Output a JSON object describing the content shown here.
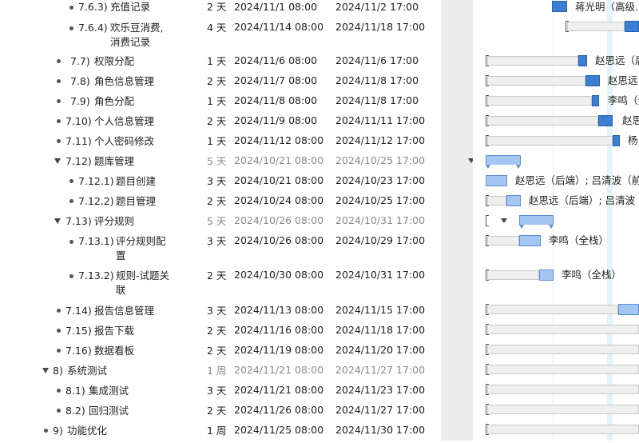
{
  "tasks": [
    {
      "num": "7.6.3)",
      "name": "充值记录",
      "duration": "2 天",
      "start": "2024/11/1 08:00",
      "end": "2024/11/2 17:00"
    },
    {
      "num": "7.6.4)",
      "name": "欢乐豆消费,",
      "name2": "消费记录",
      "duration": "4 天",
      "start": "2024/11/14 08:00",
      "end": "2024/11/18 17:00"
    },
    {
      "num": "7.7)",
      "name": "权限分配",
      "duration": "1 天",
      "start": "2024/11/6 08:00",
      "end": "2024/11/6 17:00"
    },
    {
      "num": "7.8)",
      "name": "角色信息管理",
      "duration": "2 天",
      "start": "2024/11/7 08:00",
      "end": "2024/11/8 17:00"
    },
    {
      "num": "7.9)",
      "name": "角色分配",
      "duration": "1 天",
      "start": "2024/11/8 08:00",
      "end": "2024/11/8 17:00"
    },
    {
      "num": "7.10)",
      "name": "个人信息管理",
      "duration": "2 天",
      "start": "2024/11/9 08:00",
      "end": "2024/11/11 17:00"
    },
    {
      "num": "7.11)",
      "name": "个人密码修改",
      "duration": "1 天",
      "start": "2024/11/12 08:00",
      "end": "2024/11/12 17:00"
    },
    {
      "num": "7.12)",
      "name": "题库管理",
      "duration": "5 天",
      "start": "2024/10/21 08:00",
      "end": "2024/10/25 17:00"
    },
    {
      "num": "7.12.1)",
      "name": "题目创建",
      "duration": "3 天",
      "start": "2024/10/21 08:00",
      "end": "2024/10/23 17:00"
    },
    {
      "num": "7.12.2)",
      "name": "题目管理",
      "duration": "2 天",
      "start": "2024/10/24 08:00",
      "end": "2024/10/25 17:00"
    },
    {
      "num": "7.13)",
      "name": "评分规则",
      "duration": "5 天",
      "start": "2024/10/26 08:00",
      "end": "2024/10/31 17:00"
    },
    {
      "num": "7.13.1)",
      "name": "评分规则配",
      "name2": "置",
      "duration": "3 天",
      "start": "2024/10/26 08:00",
      "end": "2024/10/29 17:00"
    },
    {
      "num": "7.13.2)",
      "name": "规则-试题关",
      "name2": "联",
      "duration": "2 天",
      "start": "2024/10/30 08:00",
      "end": "2024/10/31 17:00"
    },
    {
      "num": "7.14)",
      "name": "报告信息管理",
      "duration": "3 天",
      "start": "2024/11/13 08:00",
      "end": "2024/11/15 17:00"
    },
    {
      "num": "7.15)",
      "name": "报告下载",
      "duration": "2 天",
      "start": "2024/11/16 08:00",
      "end": "2024/11/18 17:00"
    },
    {
      "num": "7.16)",
      "name": "数据看板",
      "duration": "2 天",
      "start": "2024/11/19 08:00",
      "end": "2024/11/20 17:00"
    },
    {
      "num": "8)",
      "name": "系统测试",
      "duration": "1 周",
      "start": "2024/11/21 08:00",
      "end": "2024/11/27 17:00"
    },
    {
      "num": "8.1)",
      "name": "集成测试",
      "duration": "3 天",
      "start": "2024/11/21 08:00",
      "end": "2024/11/23 17:00"
    },
    {
      "num": "8.2)",
      "name": "回归测试",
      "duration": "2 天",
      "start": "2024/11/26 08:00",
      "end": "2024/11/27 17:00"
    },
    {
      "num": "9)",
      "name": "功能优化",
      "duration": "1 周",
      "start": "2024/11/25 08:00",
      "end": "2024/11/30 17:00"
    }
  ],
  "resources": {
    "r0": "蒋光明（高级...",
    "r2": "赵思远（后端）",
    "r3": "赵思远",
    "r4": "李鸣（全栈）",
    "r5": "赵思",
    "r6": "杨",
    "r8": "赵思远（后端）; 吕清波（前",
    "r9": "赵思远（后端）; 吕清波",
    "r11": "李鸣（全栈）",
    "r12": "李鸣（全栈）"
  },
  "colors": {
    "bar": "#3b7ed4",
    "bar_light": "#a3c6f3",
    "track": "#efefef",
    "today": "#e3f5f9"
  }
}
